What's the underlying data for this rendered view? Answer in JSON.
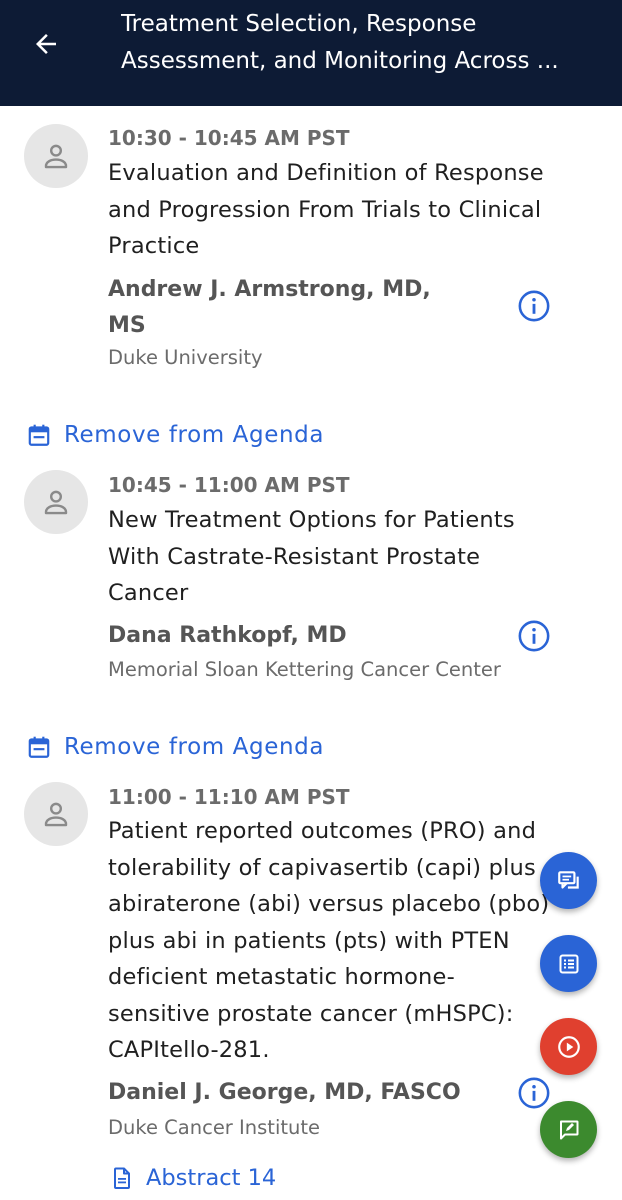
{
  "header": {
    "title_line1": "Treatment Selection, Response",
    "title_line2": "Assessment, and Monitoring Across ..."
  },
  "sessions": [
    {
      "time": "10:30 - 10:45 AM PST",
      "title_lines": [
        "Evaluation and Definition of Response",
        "and Progression From Trials to Clinical",
        "Practice"
      ],
      "speaker_lines": [
        "Andrew J. Armstrong,  MD,",
        "MS"
      ],
      "affiliation": "Duke University"
    },
    {
      "time": "10:45 - 11:00 AM PST",
      "title_lines": [
        "New Treatment Options for Patients",
        "With Castrate-Resistant Prostate",
        "Cancer"
      ],
      "speaker_lines": [
        "Dana Rathkopf,  MD"
      ],
      "affiliation": "Memorial Sloan Kettering Cancer Center"
    },
    {
      "time": "11:00 - 11:10 AM PST",
      "title_lines": [
        "Patient reported outcomes (PRO) and",
        "tolerability of capivasertib (capi) plus",
        "abiraterone (abi) versus placebo (pbo)",
        "plus abi in patients (pts) with PTEN",
        "deficient metastatic hormone-",
        "sensitive prostate cancer (mHSPC):",
        "CAPItello-281."
      ],
      "speaker_lines": [
        "Daniel J. George, MD, FASCO"
      ],
      "affiliation": "Duke Cancer Institute"
    }
  ],
  "agenda_label": "Remove from Agenda",
  "abstract_label": "Abstract 14",
  "colors": {
    "header_bg": "#0d1b35",
    "accent_blue": "#2a64d6",
    "fab_red": "#e0402f",
    "fab_green": "#3c8a2e"
  },
  "icons": {
    "back": "arrow-back-icon",
    "avatar": "person-icon",
    "info": "info-icon",
    "agenda": "calendar-icon",
    "abstract": "document-icon",
    "fab_chat": "chat-icon",
    "fab_list": "list-icon",
    "fab_play": "play-icon",
    "fab_feedback": "feedback-icon"
  }
}
